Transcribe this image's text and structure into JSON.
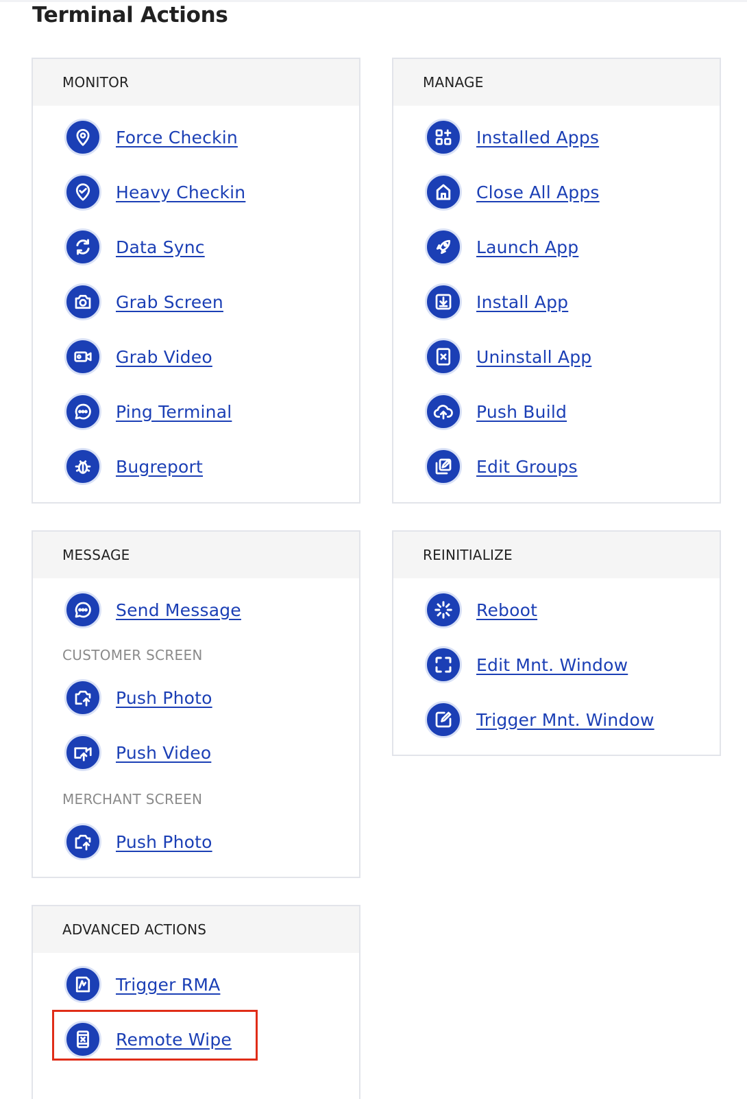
{
  "page": {
    "title": "Terminal Actions"
  },
  "monitor": {
    "title": "MONITOR",
    "items": [
      {
        "label": "Force Checkin",
        "icon": "location-pin-icon"
      },
      {
        "label": "Heavy Checkin",
        "icon": "heart-pin-icon"
      },
      {
        "label": "Data Sync",
        "icon": "sync-icon"
      },
      {
        "label": "Grab Screen",
        "icon": "camera-icon"
      },
      {
        "label": "Grab Video",
        "icon": "video-camera-icon"
      },
      {
        "label": "Ping Terminal",
        "icon": "chat-bubble-icon"
      },
      {
        "label": "Bugreport",
        "icon": "bug-icon"
      }
    ]
  },
  "manage": {
    "title": "MANAGE",
    "items": [
      {
        "label": "Installed Apps",
        "icon": "apps-grid-icon"
      },
      {
        "label": "Close All Apps",
        "icon": "home-icon"
      },
      {
        "label": "Launch App",
        "icon": "rocket-icon"
      },
      {
        "label": "Install App",
        "icon": "download-box-icon"
      },
      {
        "label": "Uninstall App",
        "icon": "remove-box-icon"
      },
      {
        "label": "Push Build",
        "icon": "cloud-upload-icon"
      },
      {
        "label": "Edit Groups",
        "icon": "edit-layers-icon"
      }
    ]
  },
  "message": {
    "title": "MESSAGE",
    "send": {
      "label": "Send Message",
      "icon": "chat-bubble-icon"
    },
    "customer_screen": {
      "title": "CUSTOMER SCREEN",
      "items": [
        {
          "label": "Push Photo",
          "icon": "push-photo-icon"
        },
        {
          "label": "Push Video",
          "icon": "push-video-icon"
        }
      ]
    },
    "merchant_screen": {
      "title": "MERCHANT SCREEN",
      "items": [
        {
          "label": "Push Photo",
          "icon": "push-photo-icon"
        }
      ]
    }
  },
  "reinitialize": {
    "title": "REINITIALIZE",
    "items": [
      {
        "label": "Reboot",
        "icon": "spinner-icon"
      },
      {
        "label": "Edit Mnt. Window",
        "icon": "frame-icon"
      },
      {
        "label": "Trigger Mnt. Window",
        "icon": "edit-box-icon"
      }
    ]
  },
  "advanced": {
    "title": "ADVANCED ACTIONS",
    "items": [
      {
        "label": "Trigger RMA",
        "icon": "rma-icon"
      },
      {
        "label": "Remote Wipe",
        "icon": "wipe-device-icon"
      }
    ]
  },
  "colors": {
    "accent": "#1b3fb5",
    "icon_ring": "#d9e1f6",
    "highlight": "#e02d18",
    "header_bg": "#f5f5f5",
    "border": "#e2e4ea"
  }
}
